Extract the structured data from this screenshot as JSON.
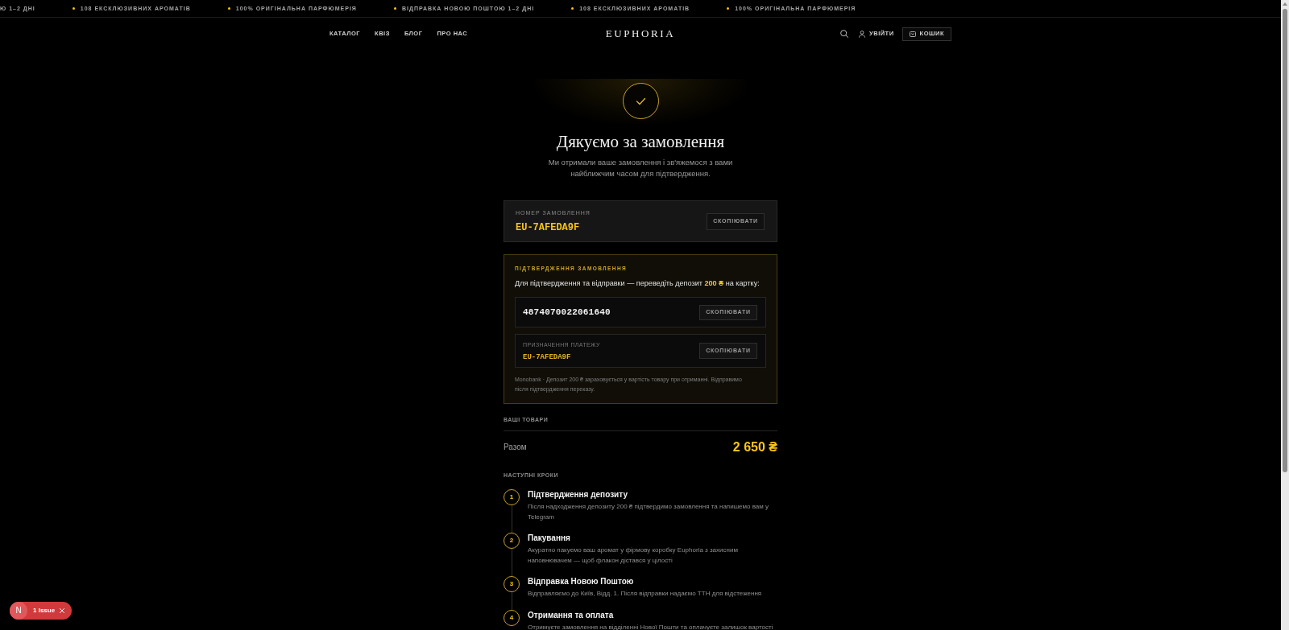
{
  "announcement_bar": {
    "items": [
      {
        "text": "Ю 1–2 ДНІ",
        "bullet": false
      },
      {
        "text": "108 ЕКСКЛЮЗИВНИХ АРОМАТІВ",
        "bullet": true
      },
      {
        "text": "100% ОРИГІНАЛЬНА ПАРФЮМЕРІЯ",
        "bullet": true
      },
      {
        "text": "ВІДПРАВКА НОВОЮ ПОШТОЮ 1–2 ДНІ",
        "bullet": true
      },
      {
        "text": "108 ЕКСКЛЮЗИВНИХ АРОМАТІВ",
        "bullet": true
      },
      {
        "text": "100% ОРИГІНАЛЬНА ПАРФЮМЕРІЯ",
        "bullet": true
      }
    ]
  },
  "header": {
    "nav": [
      "КАТАЛОГ",
      "КВІЗ",
      "БЛОГ",
      "ПРО НАС"
    ],
    "logo": "EUPHORIA",
    "login": "УВІЙТИ",
    "cart": "КОШИК"
  },
  "hero": {
    "title": "Дякуємо за замовлення",
    "subtitle": "Ми отримали ваше замовлення і зв'яжемося з вами найближчим часом для підтвердження."
  },
  "order_number": {
    "label": "НОМЕР ЗАМОВЛЕННЯ",
    "value": "EU-7AFEDA9F",
    "button": "СКОПІЮВАТИ"
  },
  "confirmation": {
    "heading": "ПІДТВЕРДЖЕННЯ ЗАМОВЛЕННЯ",
    "instruction": "Для підтвердження та відправки — переведіть депозит **200 ₴** на картку:",
    "card": {
      "number": "4874070022061640",
      "button": "СКОПІЮВАТИ"
    },
    "purpose": {
      "label": "ПРИЗНАЧЕННЯ ПЛАТЕЖУ",
      "value": "EU-7AFEDA9F",
      "button": "СКОПІЮВАТИ"
    },
    "note": "Monobank · Депозит 200 ₴ зараховується у вартість товару при отриманні. Відправимо після підтвердження переказу."
  },
  "items_section": {
    "heading": "ВАШІ ТОВАРИ",
    "total_label": "Разом",
    "total_value": "2 650 ₴"
  },
  "next_steps": {
    "heading": "НАСТУПНІ КРОКИ",
    "steps": [
      {
        "number": "1",
        "title": "Підтвердження депозиту",
        "description": "Після надходження депозиту 200 ₴ підтвердимо замовлення та напишемо вам у Telegram"
      },
      {
        "number": "2",
        "title": "Пакування",
        "description": "Акуратно пакуємо ваш аромат у фірмову коробку Euphoria з захисним наповнювачем — щоб флакон дістався у цілості"
      },
      {
        "number": "3",
        "title": "Відправка Новою Поштою",
        "description": "Відправляємо до Київ, Відд. 1. Після відправки надаємо ТТН для відстеження"
      },
      {
        "number": "4",
        "title": "Отримання та оплата",
        "description": "Отримуєте замовлення на відділенні Нової Пошти та оплачуєте залишок вартості"
      }
    ]
  },
  "dev_overlay": {
    "logo": "N",
    "label": "1 Issue"
  }
}
